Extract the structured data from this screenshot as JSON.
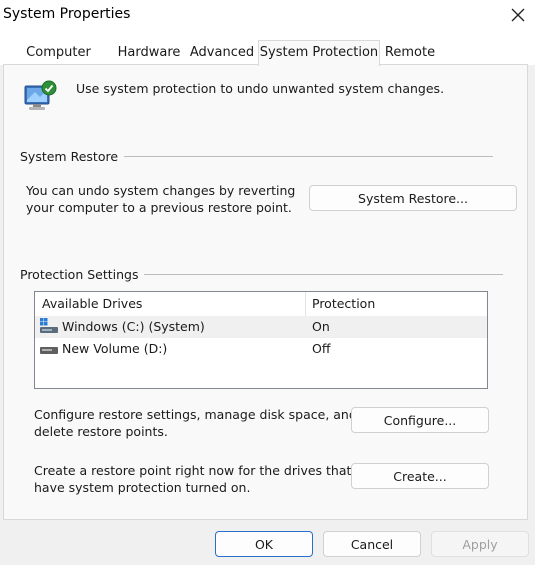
{
  "window": {
    "title": "System Properties",
    "close_icon": "close-icon"
  },
  "tabs": [
    {
      "label": "Computer Name",
      "active": false
    },
    {
      "label": "Hardware",
      "active": false
    },
    {
      "label": "Advanced",
      "active": false
    },
    {
      "label": "System Protection",
      "active": true
    },
    {
      "label": "Remote",
      "active": false
    }
  ],
  "intro": {
    "text": "Use system protection to undo unwanted system changes.",
    "icon": "system-protection-icon"
  },
  "system_restore": {
    "section_label": "System Restore",
    "description_line1": "You can undo system changes by reverting",
    "description_line2": "your computer to a previous restore point.",
    "button_label": "System Restore..."
  },
  "protection_settings": {
    "section_label": "Protection Settings",
    "columns": [
      "Available Drives",
      "Protection"
    ],
    "drives": [
      {
        "name": "Windows (C:) (System)",
        "protection": "On",
        "icon": "windows-drive-icon",
        "selected": true
      },
      {
        "name": "New Volume (D:)",
        "protection": "Off",
        "icon": "drive-icon",
        "selected": false
      }
    ],
    "configure_text_line1": "Configure restore settings, manage disk space, and",
    "configure_text_line2": "delete restore points.",
    "configure_button": "Configure...",
    "create_text_line1": "Create a restore point right now for the drives that",
    "create_text_line2": "have system protection turned on.",
    "create_button": "Create..."
  },
  "footer": {
    "ok": "OK",
    "cancel": "Cancel",
    "apply": "Apply"
  },
  "colors": {
    "accent": "#2a6ec9",
    "panel": "#f9f9f9",
    "window": "#f0f0f0"
  }
}
